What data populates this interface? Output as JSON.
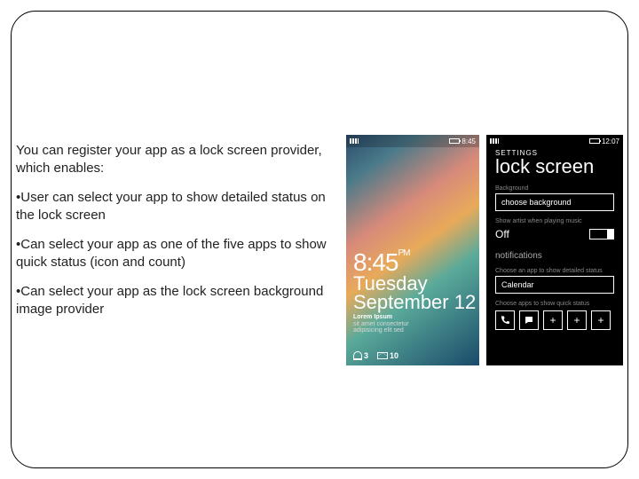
{
  "text": {
    "intro": "You can register your app as a lock screen provider, which enables:",
    "b1": "•User can select your app to show detailed status on the lock screen",
    "b2": "•Can select your app as one of the five apps to show quick status (icon and count)",
    "b3": "•Can select your app as the lock screen background image provider"
  },
  "lock": {
    "statusTime": "8:45",
    "time": "8:45",
    "ampm": "PM",
    "day": "Tuesday",
    "date": "September 12",
    "lorem1": "Lorem Ipsum",
    "lorem2": "sit amet consectetur",
    "lorem3": "adipisicing elit sed",
    "count1": "3",
    "count2": "10"
  },
  "settings": {
    "statusTime": "12:07",
    "header": "SETTINGS",
    "title": "lock screen",
    "bgLabel": "Background",
    "bgValue": "choose background",
    "artistLabel": "Show artist when playing music",
    "artistValue": "Off",
    "notif": "notifications",
    "detailLabel": "Choose an app to show detailed status",
    "detailValue": "Calendar",
    "quickLabel": "Choose apps to show quick status",
    "plus": "+"
  }
}
